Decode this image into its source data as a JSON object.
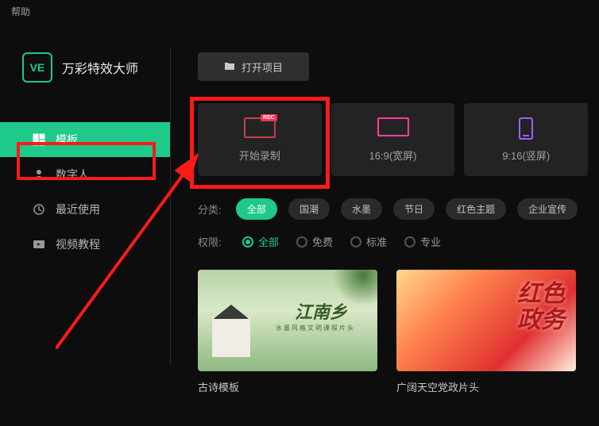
{
  "titlebar": {
    "help": "帮助"
  },
  "logo": {
    "badge": "VE",
    "title": "万彩特效大师"
  },
  "nav": {
    "templates": "模板",
    "digital_human": "数字人",
    "recent": "最近使用",
    "tutorials": "视频教程"
  },
  "toolbar": {
    "open_project": "打开项目"
  },
  "cards": {
    "record": "开始录制",
    "wide": "16:9(宽屏)",
    "tall": "9:16(竖屏)"
  },
  "filters": {
    "category_label": "分类:",
    "categories": [
      "全部",
      "国潮",
      "水墨",
      "节日",
      "红色主题",
      "企业宣传"
    ],
    "permission_label": "权限:",
    "permissions": [
      "全部",
      "免费",
      "标准",
      "专业"
    ]
  },
  "templates": {
    "t1": {
      "title": "古诗模板",
      "thumb_title": "江南乡",
      "thumb_sub": "水墨风格文明课程片头"
    },
    "t2": {
      "title": "广阔天空党政片头",
      "thumb_calli1": "红色",
      "thumb_calli2": "政务"
    }
  }
}
